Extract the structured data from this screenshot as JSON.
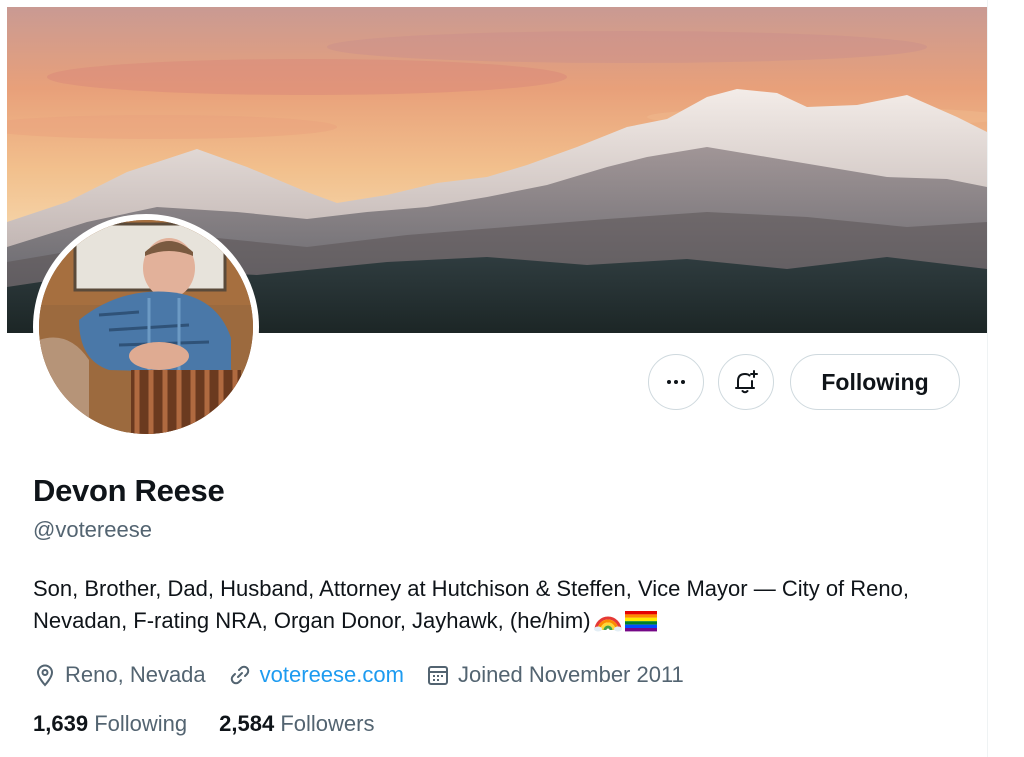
{
  "profile": {
    "display_name": "Devon Reese",
    "handle": "@votereese",
    "bio": "Son, Brother, Dad, Husband, Attorney at Hutchison & Steffen, Vice Mayor — City of Reno, Nevadan, F-rating NRA, Organ Donor, Jayhawk, (he/him)",
    "bio_emojis": [
      "rainbow-emoji",
      "pride-flag-emoji"
    ],
    "location": "Reno, Nevada",
    "website": "votereese.com",
    "joined": "Joined November 2011"
  },
  "actions": {
    "more_icon": "more-icon",
    "notify_icon": "bell-plus-icon",
    "follow_label": "Following"
  },
  "stats": {
    "following_count": "1,639",
    "following_label": "Following",
    "followers_count": "2,584",
    "followers_label": "Followers"
  },
  "colors": {
    "link": "#1d9bf0",
    "secondary_text": "#536471",
    "primary_text": "#0f1419",
    "border": "#cfd9de"
  }
}
